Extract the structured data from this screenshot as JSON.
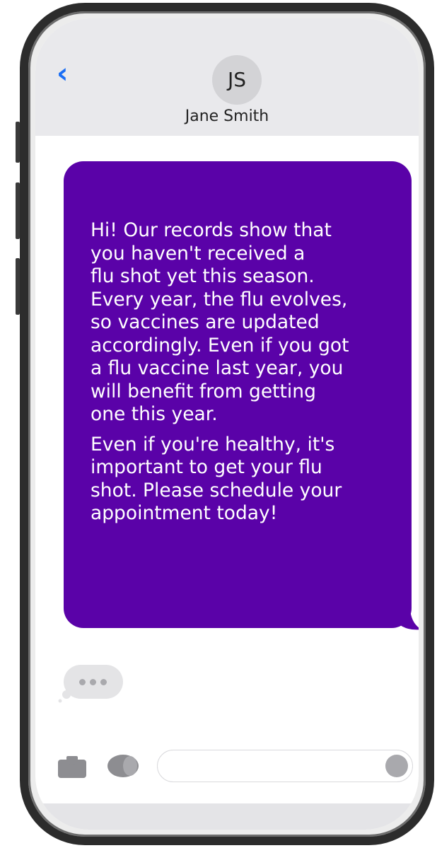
{
  "header": {
    "back_icon": "chevron-left-icon",
    "avatar_initials": "JS",
    "contact_name": "Jane Smith"
  },
  "conversation": {
    "messages": [
      {
        "paragraphs": [
          "Hi! Our records show that\nyou haven't received a\nflu shot yet this season.\nEvery year, the flu evolves,\nso vaccines are updated\naccordingly. Even if you got\na flu vaccine last year, you\nwill benefit from getting\none this year.",
          "Even if you're healthy, it's\nimportant to get your flu\nshot. Please schedule your\nappointment today!"
        ],
        "bubble_color": "#5a02a8",
        "text_color": "#ffffff"
      }
    ],
    "typing_indicator_icon": "typing-dots-icon"
  },
  "input_bar": {
    "camera_icon": "camera-icon",
    "apps_icon": "app-store-icon",
    "message_value": "",
    "send_icon": "send-icon"
  },
  "colors": {
    "accent": "#1a6ef5",
    "header_bg": "#e9e9ec",
    "frame": "#2c2c2c"
  }
}
